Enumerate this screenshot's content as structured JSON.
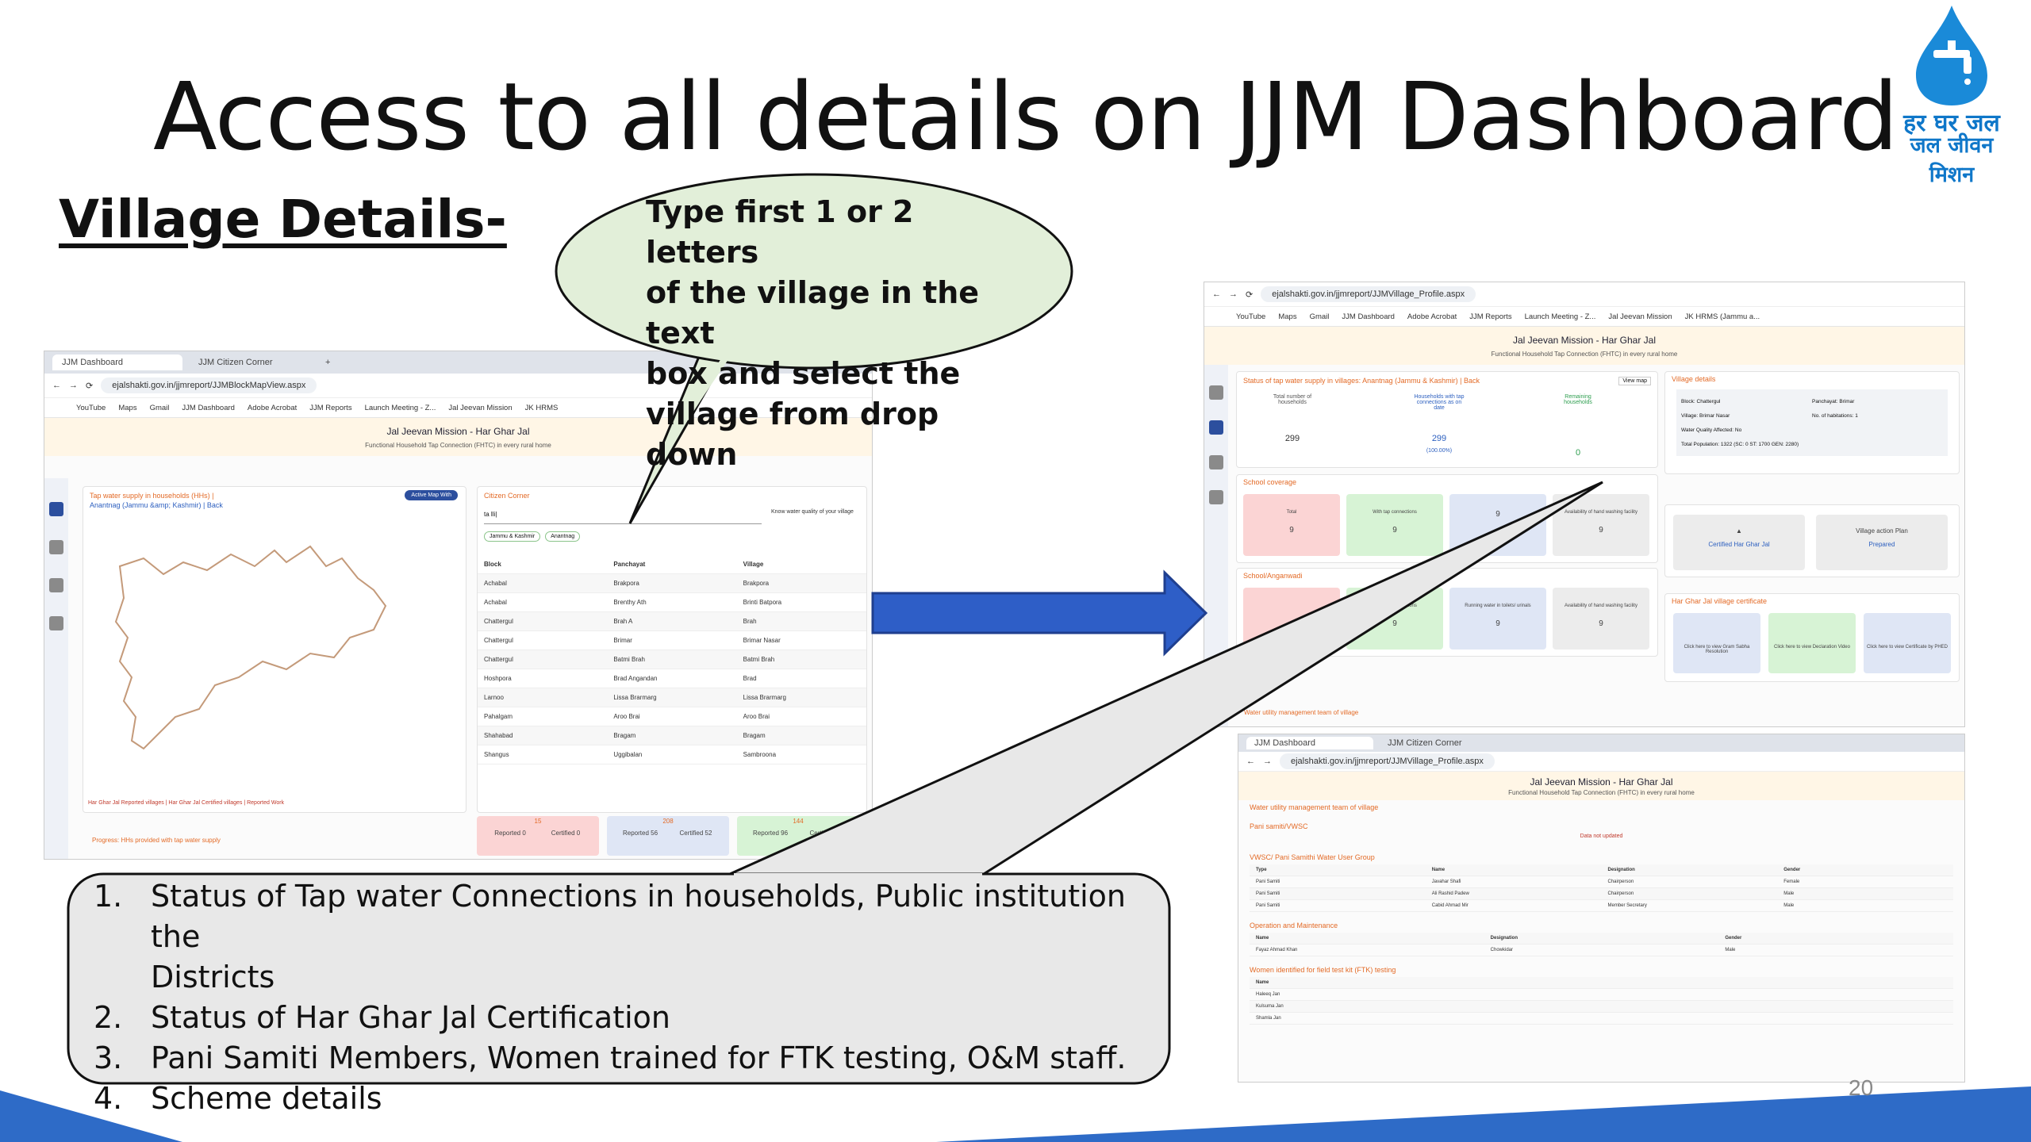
{
  "slide": {
    "title": "Access to all details on JJM Dashboard",
    "section": "Village Details-",
    "page_number": "20"
  },
  "logo": {
    "line1": "हर घर जल",
    "line2": "जल जीवन मिशन",
    "color": "#0f77c9"
  },
  "callout_bubble": {
    "lines": [
      "Type first 1 or 2 letters",
      "of the village in the text",
      "box and select the",
      "village from drop down"
    ]
  },
  "steps": [
    {
      "num": "1.",
      "lines": [
        "Status of Tap water Connections in households, Public institution the",
        "Districts"
      ]
    },
    {
      "num": "2.",
      "lines": [
        "Status of Har Ghar Jal Certification"
      ]
    },
    {
      "num": "3.",
      "lines": [
        "Pani Samiti Members, Women trained for FTK testing, O&M staff."
      ]
    },
    {
      "num": "4.",
      "lines": [
        "Scheme details"
      ]
    }
  ],
  "left_screenshot": {
    "tabs": [
      "JJM Dashboard",
      "JJM Citizen Corner"
    ],
    "url": "ejalshakti.gov.in/jjmreport/JJMBlockMapView.aspx",
    "bookmarks": [
      "YouTube",
      "Maps",
      "Gmail",
      "JJM Dashboard",
      "Adobe Acrobat",
      "JJM Reports",
      "Launch Meeting - Z...",
      "Jal Jeevan Mission",
      "JK HRMS"
    ],
    "site_title": "Jal Jeevan Mission - Har Ghar Jal",
    "site_subtitle": "Functional Household Tap Connection (FHTC) in every rural home",
    "map_panel_title": "Tap water supply in households (HHs) |",
    "map_panel_breadcrumb": "Anantnag (Jammu &amp; Kashmir) | Back",
    "corner_title": "Citizen Corner",
    "search_value": "ta lli|",
    "chips": [
      "Jammu & Kashmir",
      "Anantnag"
    ],
    "water_quality_hint": "Know water quality of your village",
    "table_headers": [
      "Block",
      "Panchayat",
      "Village"
    ],
    "table_rows": [
      [
        "Achabal",
        "Brakpora",
        "Brakpora"
      ],
      [
        "Achabal",
        "Brenthy Ath",
        "Brinti Batpora"
      ],
      [
        "Chattergul",
        "Brah A",
        "Brah"
      ],
      [
        "Chattergul",
        "Brimar",
        "Brimar Nasar"
      ],
      [
        "Chattergul",
        "Batmi Brah",
        "Batmi Brah"
      ],
      [
        "Hoshpora",
        "Brad Angandan",
        "Brad"
      ],
      [
        "Larnoo",
        "Lissa Brarmarg",
        "Lissa Brarmarg"
      ],
      [
        "Pahalgam",
        "Aroo Brai",
        "Aroo Brai"
      ],
      [
        "Shahabad",
        "Bragam",
        "Bragam"
      ],
      [
        "Shangus",
        "Uggibalan",
        "Sambroona"
      ]
    ],
    "cards": [
      {
        "top": "15",
        "a": "Reported 0",
        "b": "Certified 0",
        "color": "#fbd4d4"
      },
      {
        "top": "208",
        "a": "Reported 56",
        "b": "Certified 52",
        "color": "#dfe6f5"
      },
      {
        "top": "144",
        "a": "Reported 96",
        "b": "Certified 79",
        "color": "#d7f3d5"
      }
    ],
    "legend": "Har Ghar Jal Reported villages | Har Ghar Jal Certified villages | Reported Work",
    "progress_label": "Progress: HHs provided with tap water supply",
    "toggle_label": "Active Map With"
  },
  "right_screenshot_top": {
    "url": "ejalshakti.gov.in/jjmreport/JJMVillage_Profile.aspx",
    "bookmarks": [
      "YouTube",
      "Maps",
      "Gmail",
      "JJM Dashboard",
      "Adobe Acrobat",
      "JJM Reports",
      "Launch Meeting - Z...",
      "Jal Jeevan Mission",
      "JK HRMS (Jammu a..."
    ],
    "site_title": "Jal Jeevan Mission - Har Ghar Jal",
    "site_subtitle": "Functional Household Tap Connection (FHTC) in every rural home",
    "status_title": "Status of tap water supply in villages: Anantnag (Jammu & Kashmir) | Back",
    "view_map": "View map",
    "stats": [
      {
        "label": "Total number of households",
        "value": "299"
      },
      {
        "label": "Households with tap connections as on date",
        "value": "299",
        "sub": "(100.00%)"
      },
      {
        "label": "Remaining households",
        "value": "0"
      }
    ],
    "school_title": "School coverage",
    "school_cards": [
      {
        "label": "Total",
        "value": "9",
        "color": "#fbd4d4"
      },
      {
        "label": "With tap connections",
        "value": "9",
        "color": "#d7f3d5"
      },
      {
        "label": "",
        "value": "9",
        "color": "#dfe6f5"
      },
      {
        "label": "Availability of hand washing facility",
        "value": "9",
        "color": "#ececec"
      }
    ],
    "aw_title": "School/Anganwadi",
    "aw_cards": [
      {
        "label": "",
        "value": "",
        "color": "#fbd4d4"
      },
      {
        "label": "With tap connections",
        "value": "9",
        "color": "#d7f3d5"
      },
      {
        "label": "Running water in toilets/ urinals",
        "value": "9",
        "color": "#dfe6f5"
      },
      {
        "label": "Availability of hand washing facility",
        "value": "9",
        "color": "#ececec"
      }
    ],
    "village_details_title": "Village details",
    "village_details": [
      [
        "Block: Chattergul",
        "Panchayat: Brimar"
      ],
      [
        "Village: Brimar Nasar",
        "No. of habitations: 1"
      ],
      [
        "Water Quality Affected: No",
        ""
      ],
      [
        "Total Population: 1322 (SC: 0 ST: 1700 GEN: 2280)",
        ""
      ]
    ],
    "certification_items": [
      "Certified Har Ghar Jal",
      "Village action Plan"
    ],
    "certification_sub": [
      "",
      "Prepared"
    ],
    "certificate_title": "Har Ghar Jal village certificate",
    "certificate_cards": [
      "Click here to view Gram Sabha Resolution",
      "Click here to view Declaration Video",
      "Click here to view Certificate by PHED"
    ],
    "footer_title": "Water utility management team of village"
  },
  "right_screenshot_bottom": {
    "tabs": [
      "JJM Dashboard",
      "JJM Citizen Corner"
    ],
    "url": "ejalshakti.gov.in/jjmreport/JJMVillage_Profile.aspx",
    "site_title": "Jal Jeevan Mission - Har Ghar Jal",
    "site_subtitle": "Functional Household Tap Connection (FHTC) in every rural home",
    "section1": "Water utility management team of village",
    "section1_sub": "Pani samiti/VWSC",
    "section1_note": "Data not updated",
    "section2": "VWSC/ Pani Samithi Water User Group",
    "section2_headers": [
      "Type",
      "Name",
      "Designation",
      "Gender"
    ],
    "section2_rows": [
      [
        "Pani Samiti",
        "Javahar Shafi",
        "Chairperson",
        "Female"
      ],
      [
        "Pani Samiti",
        "Ali Rashid Padew",
        "Chairperson",
        "Male"
      ],
      [
        "Pani Samiti",
        "Cabid Ahmad Mir",
        "Member Secretary",
        "Male"
      ]
    ],
    "section3": "Operation and Maintenance",
    "section3_headers": [
      "Name",
      "Designation",
      "Gender"
    ],
    "section3_rows": [
      [
        "Fayaz Ahmad Khan",
        "Chowkidar",
        "Male"
      ]
    ],
    "section4": "Women identified for field test kit (FTK) testing",
    "section4_headers": [
      "Name"
    ],
    "section4_rows": [
      [
        "Haleeq Jan"
      ],
      [
        "Kulsuma Jan"
      ],
      [
        "Shamla Jan"
      ]
    ]
  },
  "colors": {
    "arrow": "#2e5ec7",
    "arrow_border": "#1f3f8f",
    "bubble_fill": "#e2efd9",
    "box_fill": "#e8e8e8",
    "floor": "#2e6bc7"
  }
}
